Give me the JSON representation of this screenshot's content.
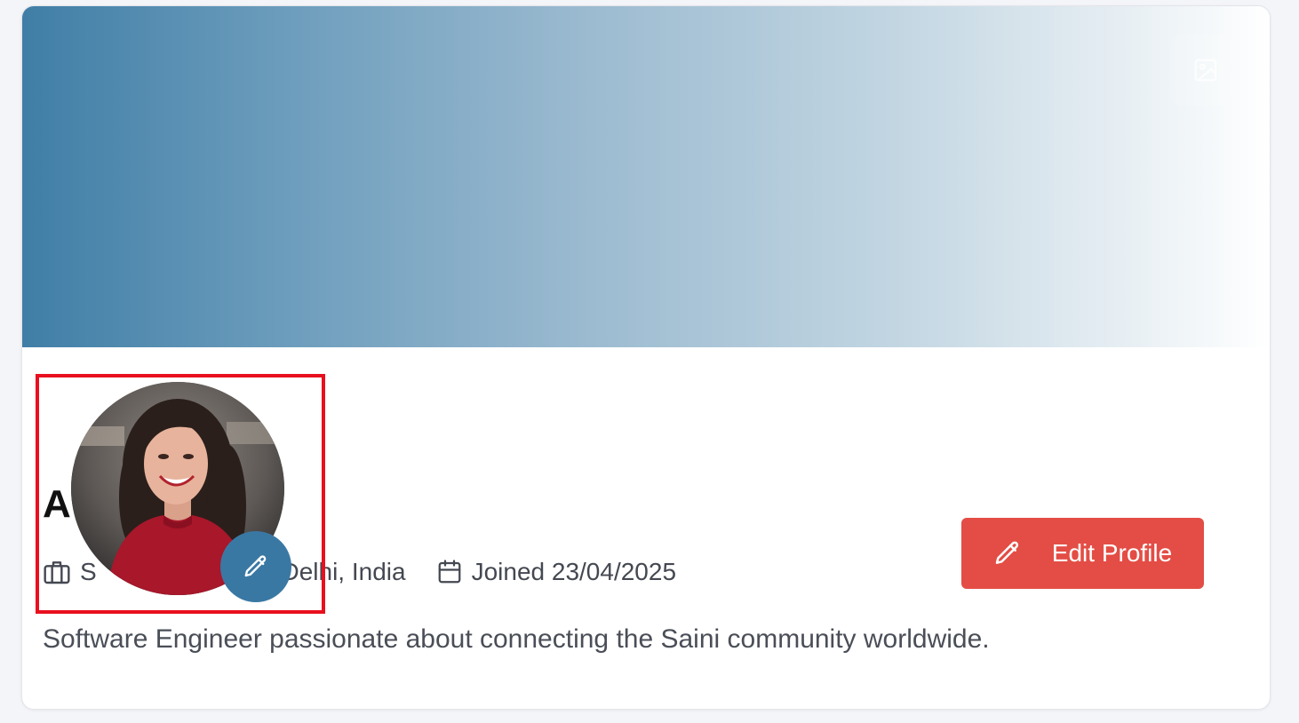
{
  "cover": {
    "gradient_start": "#407ea6",
    "gradient_end": "#ffffff",
    "change_cover_icon": "image-icon"
  },
  "profile": {
    "name": "A     ni",
    "occupation": "S            eer",
    "location": "Delhi, India",
    "joined": "Joined 23/04/2025",
    "bio": "Software Engineer passionate about connecting the Saini community worldwide."
  },
  "actions": {
    "edit_profile_label": "Edit Profile",
    "edit_profile_color": "#e34d45"
  },
  "avatar": {
    "edit_button_color": "#3a78a4",
    "highlight_color": "#e8101e"
  }
}
